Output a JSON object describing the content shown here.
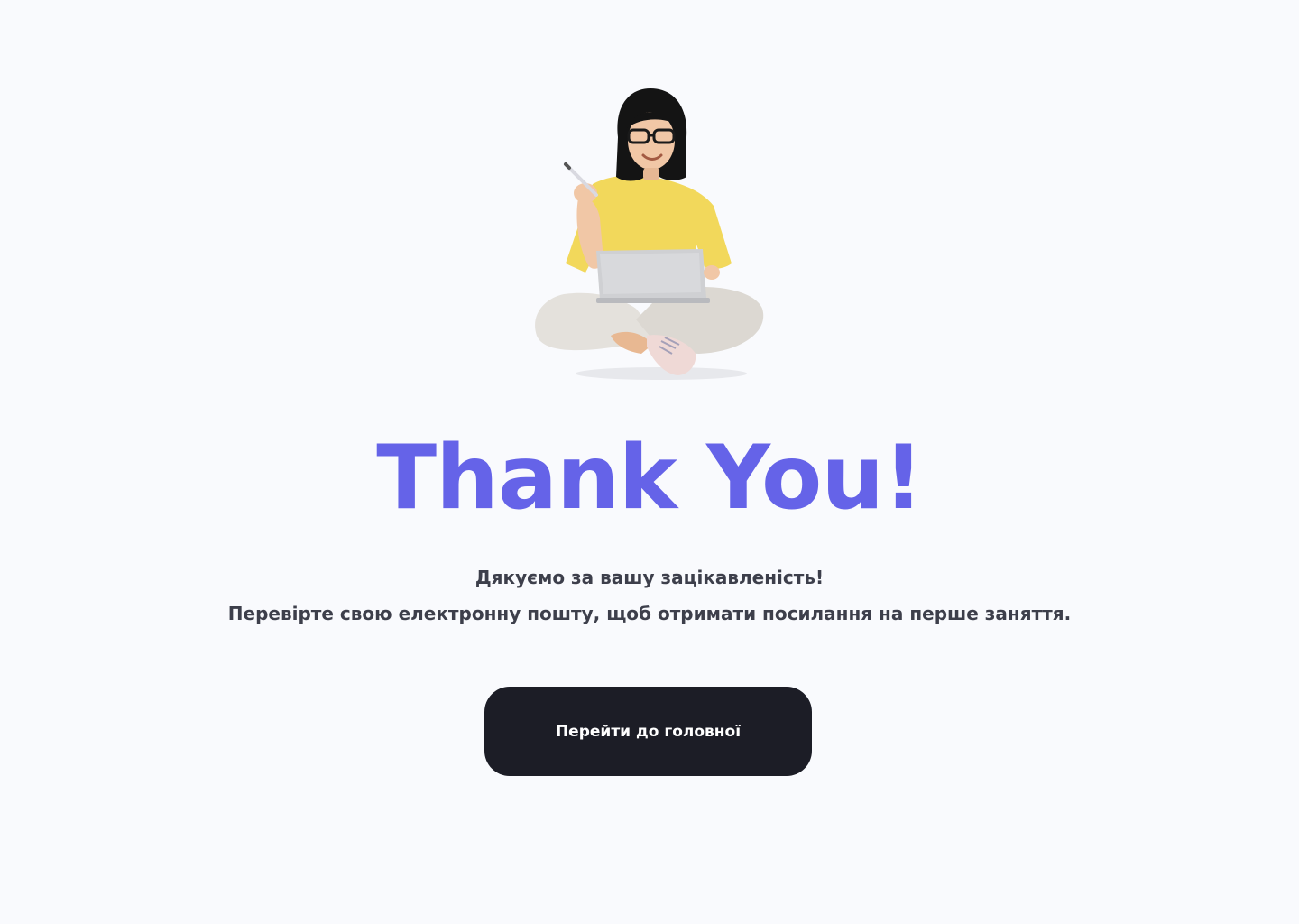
{
  "illustration": {
    "icon": "woman-with-laptop-illustration",
    "colors": {
      "hair": "#141414",
      "skin": "#f1c7a6",
      "shirt": "#f2d85b",
      "pants": "#e4e1dc",
      "laptop": "#cfd0d3",
      "shoes": "#efd9d6"
    }
  },
  "main": {
    "title": "Thank You!",
    "line1": "Дякуємо за вашу зацікавленість!",
    "line2": "Перевірте свою електронну пошту, щоб отримати посилання на перше заняття.",
    "button_label": "Перейти до головної"
  },
  "colors": {
    "background": "#f9fafd",
    "accent": "#6563e8",
    "text": "#3d3f4b",
    "button": "#1c1d26",
    "button_text": "#ffffff"
  }
}
